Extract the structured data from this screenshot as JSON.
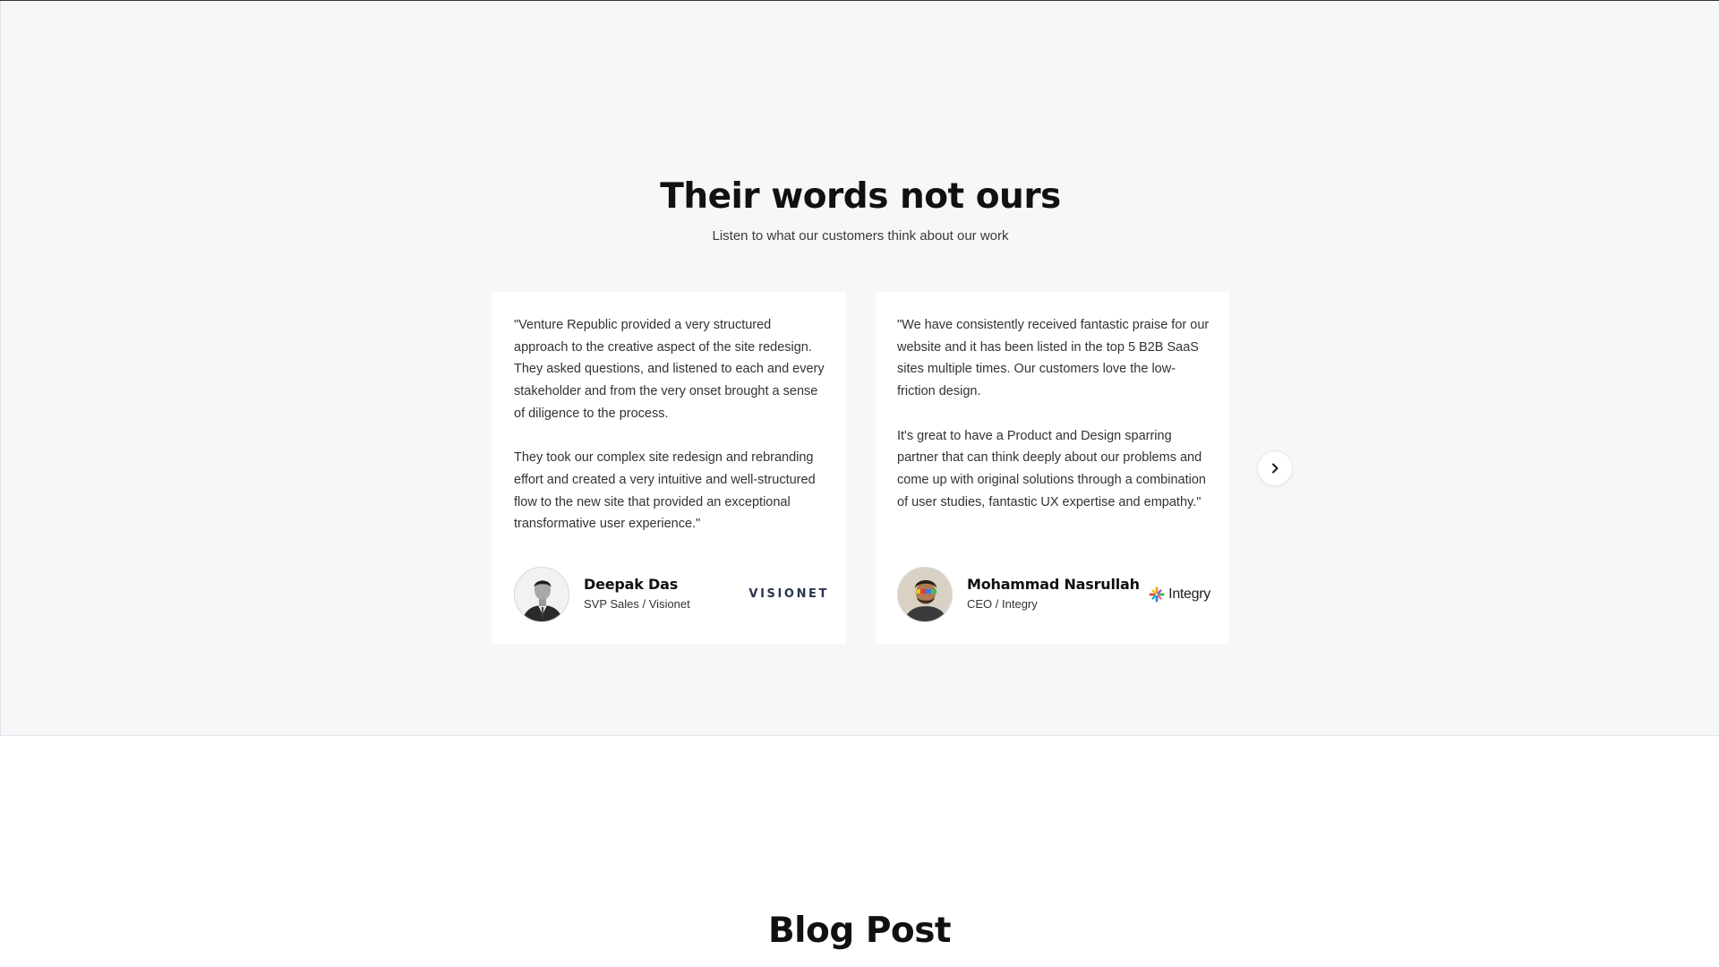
{
  "testimonials": {
    "title": "Their words not ours",
    "subtitle": "Listen to what our customers think about our work",
    "cards": [
      {
        "paragraphs": [
          "\"Venture Republic provided a very structured approach to the creative aspect of the site redesign. They asked questions, and listened to each and every stakeholder and from the very onset brought a sense of diligence to the process.",
          "They took our complex site redesign and rebranding effort and created a very intuitive and well-structured flow to the new site that provided an exceptional transformative user experience.\""
        ],
        "name": "Deepak Das",
        "role": "SVP Sales / Visionet",
        "company_logo_text": "VISIONET"
      },
      {
        "paragraphs": [
          "\"We have consistently received fantastic praise for our website and it has been listed in the top 5 B2B SaaS sites multiple times. Our customers love the low-friction design.",
          "It's great to have a Product and Design sparring partner that can think deeply about our problems and come up with original solutions through a combination of user studies, fantastic UX expertise and empathy.\""
        ],
        "name": "Mohammad Nasrullah",
        "role": "CEO / Integry",
        "company_logo_text": "Integry"
      }
    ],
    "next_icon": "chevron-right-icon"
  },
  "blog": {
    "title": "Blog Post"
  },
  "colors": {
    "section_background": "#f6f7f9",
    "card_background": "#ffffff",
    "heading": "#111111",
    "body_text": "#333333",
    "visionet_logo": "#2b3553"
  }
}
